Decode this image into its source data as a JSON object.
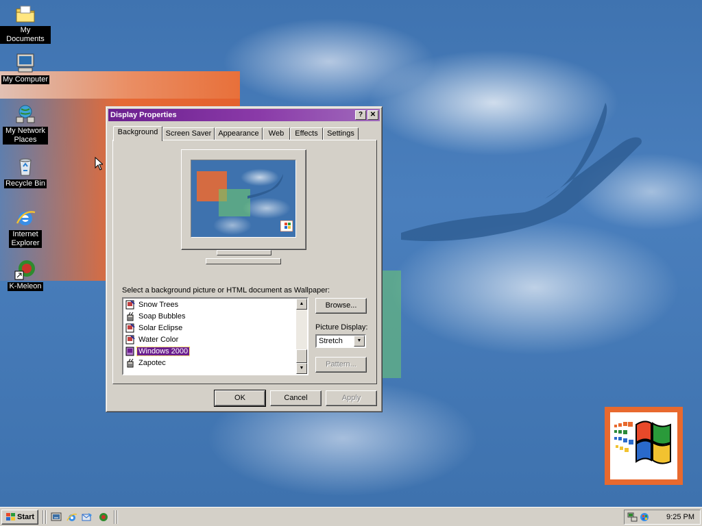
{
  "desktop": {
    "icons": [
      {
        "label": "My Documents"
      },
      {
        "label": "My Computer"
      },
      {
        "label": "My Network Places"
      },
      {
        "label": "Recycle Bin"
      },
      {
        "label": "Internet Explorer"
      },
      {
        "label": "K-Meleon"
      }
    ]
  },
  "dialog": {
    "title": "Display Properties",
    "title_buttons": {
      "help": "?",
      "close": "✕"
    },
    "tabs": [
      "Background",
      "Screen Saver",
      "Appearance",
      "Web",
      "Effects",
      "Settings"
    ],
    "active_tab": "Background",
    "wallpaper_prompt": "Select a background picture or HTML document as Wallpaper:",
    "wallpaper_list": [
      {
        "name": "Snow Trees",
        "icon": "html-doc-icon"
      },
      {
        "name": "Soap Bubbles",
        "icon": "paint-doc-icon"
      },
      {
        "name": "Solar Eclipse",
        "icon": "html-doc-icon"
      },
      {
        "name": "Water Color",
        "icon": "html-doc-icon"
      },
      {
        "name": "Windows 2000",
        "icon": "html-doc-icon",
        "selected": true
      },
      {
        "name": "Zapotec",
        "icon": "paint-doc-icon"
      }
    ],
    "browse_label": "Browse...",
    "picture_display_label": "Picture Display:",
    "picture_display_value": "Stretch",
    "pattern_label": "Pattern...",
    "ok_label": "OK",
    "cancel_label": "Cancel",
    "apply_label": "Apply"
  },
  "taskbar": {
    "start_label": "Start",
    "quick_launch": [
      "show-desktop-icon",
      "internet-explorer-icon",
      "outlook-express-icon",
      "k-meleon-icon"
    ],
    "tray_icons": [
      "network-icon",
      "windows-update-icon"
    ],
    "clock": "9:25 PM"
  },
  "colors": {
    "title_bar": "#6b1f8e",
    "selection": "#6b1f8e",
    "face": "#d4d0c8",
    "desktop": "#3a6ea5"
  }
}
